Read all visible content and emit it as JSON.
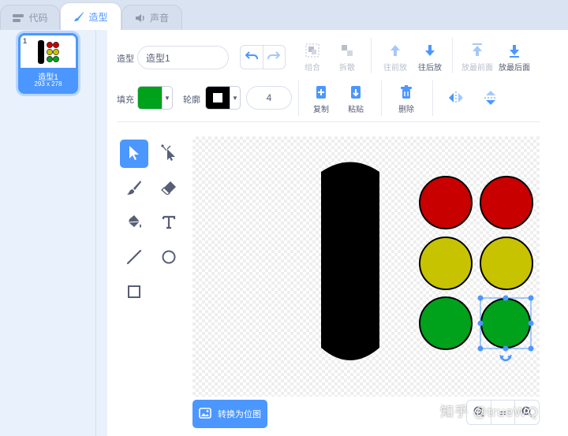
{
  "tabs": [
    {
      "label": "代码",
      "icon": "code-icon",
      "active": false
    },
    {
      "label": "造型",
      "icon": "brush-icon",
      "active": true
    },
    {
      "label": "声音",
      "icon": "speaker-icon",
      "active": false
    }
  ],
  "costume": {
    "number": "1",
    "name": "造型1",
    "size": "293 x 278"
  },
  "toolbar": {
    "costume_label": "造型",
    "costume_name_value": "造型1",
    "group_label": "组合",
    "ungroup_label": "拆散",
    "forward_label": "往前放",
    "backward_label": "往后放",
    "front_label": "放最前面",
    "back_label": "放最后面",
    "fill_label": "填充",
    "outline_label": "轮廓",
    "outline_width": "4",
    "copy_label": "复制",
    "paste_label": "粘贴",
    "delete_label": "删除"
  },
  "colors": {
    "accent": "#4c97ff",
    "fill": "#00a11b",
    "outline": "#000000",
    "red": "#c80000",
    "yellow": "#c8c300",
    "green": "#00a11b"
  },
  "drawing_tools": [
    {
      "name": "select-tool",
      "active": true
    },
    {
      "name": "reshape-tool",
      "active": false
    },
    {
      "name": "brush-tool",
      "active": false
    },
    {
      "name": "eraser-tool",
      "active": false
    },
    {
      "name": "fill-tool",
      "active": false
    },
    {
      "name": "text-tool",
      "active": false
    },
    {
      "name": "line-tool",
      "active": false
    },
    {
      "name": "circle-tool",
      "active": false
    },
    {
      "name": "rectangle-tool",
      "active": false
    }
  ],
  "footer": {
    "convert_label": "转换为位图",
    "zoom_out": "−",
    "zoom_reset": "=",
    "zoom_in": "+"
  },
  "watermark": "知乎 @trueWQ"
}
